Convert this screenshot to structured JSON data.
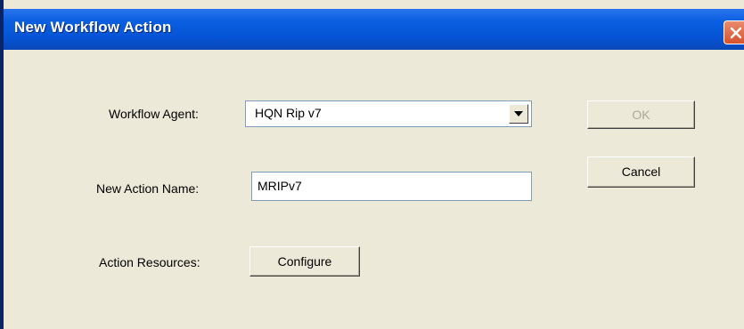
{
  "dialog": {
    "title": "New Workflow Action",
    "close_icon": "close-icon",
    "colors": {
      "title_bar": "#0654d6",
      "close_button": "#d6522c",
      "body": "#ece9d8"
    }
  },
  "form": {
    "workflow_agent_label": "Workflow Agent:",
    "workflow_agent_value": "HQN Rip v7",
    "action_name_label": "New Action Name:",
    "action_name_value": "MRIPv7",
    "resources_label": "Action Resources:",
    "configure_label": "Configure"
  },
  "buttons": {
    "ok_label": "OK",
    "ok_enabled": false,
    "cancel_label": "Cancel"
  }
}
